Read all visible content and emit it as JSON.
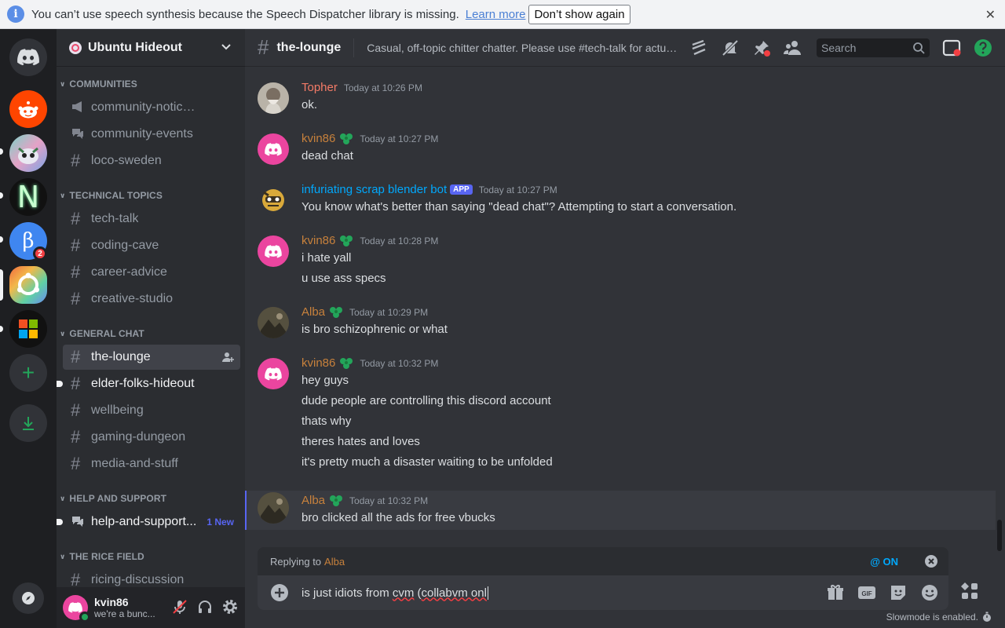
{
  "notice": {
    "text": "You can’t use speech synthesis because the Speech Dispatcher library is missing.",
    "learn_more": "Learn more",
    "dont_show": "Don’t show again"
  },
  "servers": {
    "badge_count": "2"
  },
  "server": {
    "name": "Ubuntu Hideout"
  },
  "categories": {
    "communities": "COMMUNITIES",
    "technical": "TECHNICAL TOPICS",
    "general": "GENERAL CHAT",
    "help": "HELP AND SUPPORT",
    "rice": "THE RICE FIELD"
  },
  "channels": {
    "community_noticeboard": "community-noticeboard",
    "community_events": "community-events",
    "loco_sweden": "loco-sweden",
    "tech_talk": "tech-talk",
    "coding_cave": "coding-cave",
    "career_advice": "career-advice",
    "creative_studio": "creative-studio",
    "the_lounge": "the-lounge",
    "elder_folks": "elder-folks-hideout",
    "wellbeing": "wellbeing",
    "gaming_dungeon": "gaming-dungeon",
    "media_and_stuff": "media-and-stuff",
    "help_and_support": "help-and-support...",
    "help_new": "1 New",
    "ricing": "ricing-discussion"
  },
  "user": {
    "name": "kvin86",
    "status": "we're a bunc..."
  },
  "header": {
    "channel": "the-lounge",
    "topic": "Casual, off-topic chitter chatter. Please use #tech-talk for actual...",
    "search_placeholder": "Search"
  },
  "messages": [
    {
      "author": "Topher",
      "time": "Today at 10:26 PM",
      "lines": [
        "ok."
      ]
    },
    {
      "author": "kvin86",
      "time": "Today at 10:27 PM",
      "lines": [
        "dead chat"
      ]
    },
    {
      "author": "infuriating scrap blender bot",
      "tag": "APP",
      "time": "Today at 10:27 PM",
      "lines": [
        "You know what's better than saying \"dead chat\"? Attempting to start a conversation."
      ]
    },
    {
      "author": "kvin86",
      "time": "Today at 10:28 PM",
      "lines": [
        "i hate yall",
        "u use ass specs"
      ]
    },
    {
      "author": "Alba",
      "time": "Today at 10:29 PM",
      "lines": [
        "is bro schizophrenic or what"
      ]
    },
    {
      "author": "kvin86",
      "time": "Today at 10:32 PM",
      "lines": [
        "hey guys",
        "dude people are controlling this discord account",
        "thats why",
        "theres hates and loves",
        "it's pretty much a disaster waiting to be unfolded"
      ]
    },
    {
      "author": "Alba",
      "time": "Today at 10:32 PM",
      "lines": [
        "bro clicked all the ads for free vbucks"
      ]
    }
  ],
  "reply": {
    "prefix": "Replying to",
    "name": "Alba",
    "mention": "@ ON"
  },
  "composer": {
    "text_plain": "is just idiots from ",
    "text_squiggle": "cvm",
    "text_plain2": " (",
    "text_squiggle2": "collabvm onl"
  },
  "slowmode": "Slowmode is enabled.",
  "colors": {
    "accent": "#5865f2",
    "author_orange": "#c7813c",
    "author_red": "#f47b67",
    "bot_blue": "#00a8fc",
    "online": "#23a55a"
  }
}
